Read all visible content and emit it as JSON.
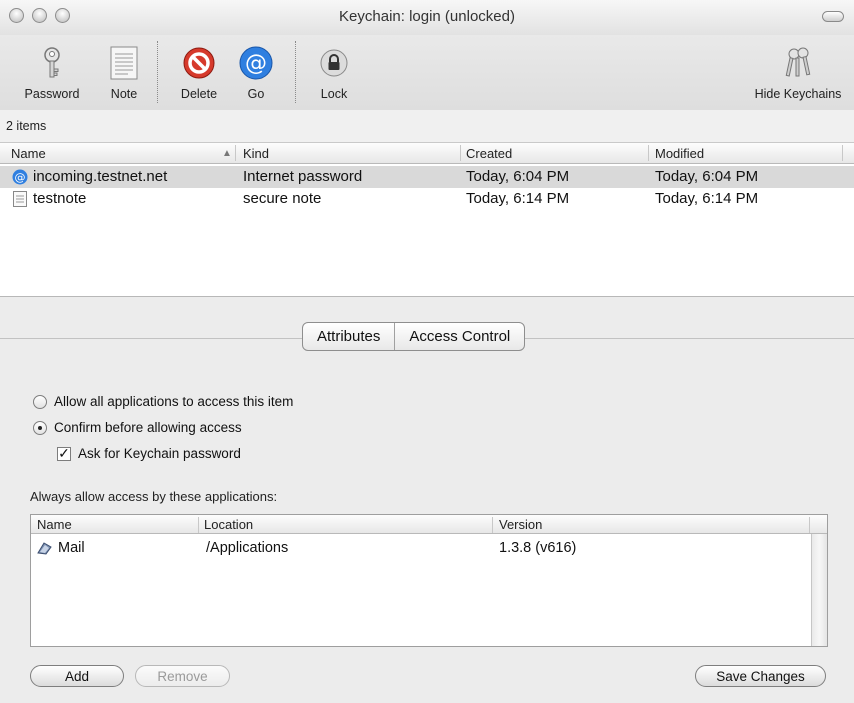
{
  "window": {
    "title": "Keychain: login (unlocked)"
  },
  "toolbar": {
    "password": "Password",
    "note": "Note",
    "delete": "Delete",
    "go": "Go",
    "lock": "Lock",
    "hide_keychains": "Hide Keychains"
  },
  "items_count": "2 items",
  "table": {
    "columns": {
      "name": "Name",
      "kind": "Kind",
      "created": "Created",
      "modified": "Modified"
    },
    "rows": [
      {
        "name": "incoming.testnet.net",
        "kind": "Internet password",
        "created": "Today, 6:04 PM",
        "modified": "Today, 6:04 PM",
        "icon": "at-icon",
        "selected": true
      },
      {
        "name": "testnote",
        "kind": "secure note",
        "created": "Today, 6:14 PM",
        "modified": "Today, 6:14 PM",
        "icon": "note-icon",
        "selected": false
      }
    ]
  },
  "tabs": {
    "attributes": "Attributes",
    "access_control": "Access Control",
    "selected": "Access Control"
  },
  "access": {
    "allow_all": "Allow all applications to access this item",
    "confirm": "Confirm before allowing access",
    "ask_password": "Ask for Keychain password",
    "always_allow": "Always allow access by these applications:"
  },
  "apps_table": {
    "columns": {
      "name": "Name",
      "location": "Location",
      "version": "Version"
    },
    "rows": [
      {
        "name": "Mail",
        "location": "/Applications",
        "version": "1.3.8 (v616)",
        "icon": "mail-app-icon"
      }
    ]
  },
  "buttons": {
    "add": "Add",
    "remove": "Remove",
    "save": "Save Changes"
  }
}
